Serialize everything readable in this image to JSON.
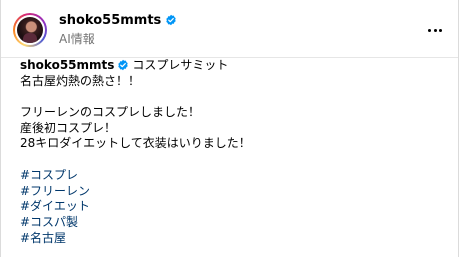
{
  "post": {
    "username": "shoko55mmts",
    "subtitle": "AI情報",
    "verified": true,
    "more_icon": "more-horizontal-icon"
  },
  "caption": {
    "username": "shoko55mmts",
    "first_line_text": "コスプレサミット",
    "lines": [
      "名古屋灼熱の熱さ！！",
      "",
      "フリーレンのコスプレしました！",
      "産後初コスプレ！",
      "28キロダイエットして衣装はいりました！",
      ""
    ],
    "hashtags": [
      "#コスプレ",
      "#フリーレン",
      "#ダイエット",
      "#コスパ製",
      "#名古屋"
    ]
  },
  "colors": {
    "verified_badge": "#0095f6",
    "hashtag": "#00376b",
    "secondary_text": "#737373"
  }
}
